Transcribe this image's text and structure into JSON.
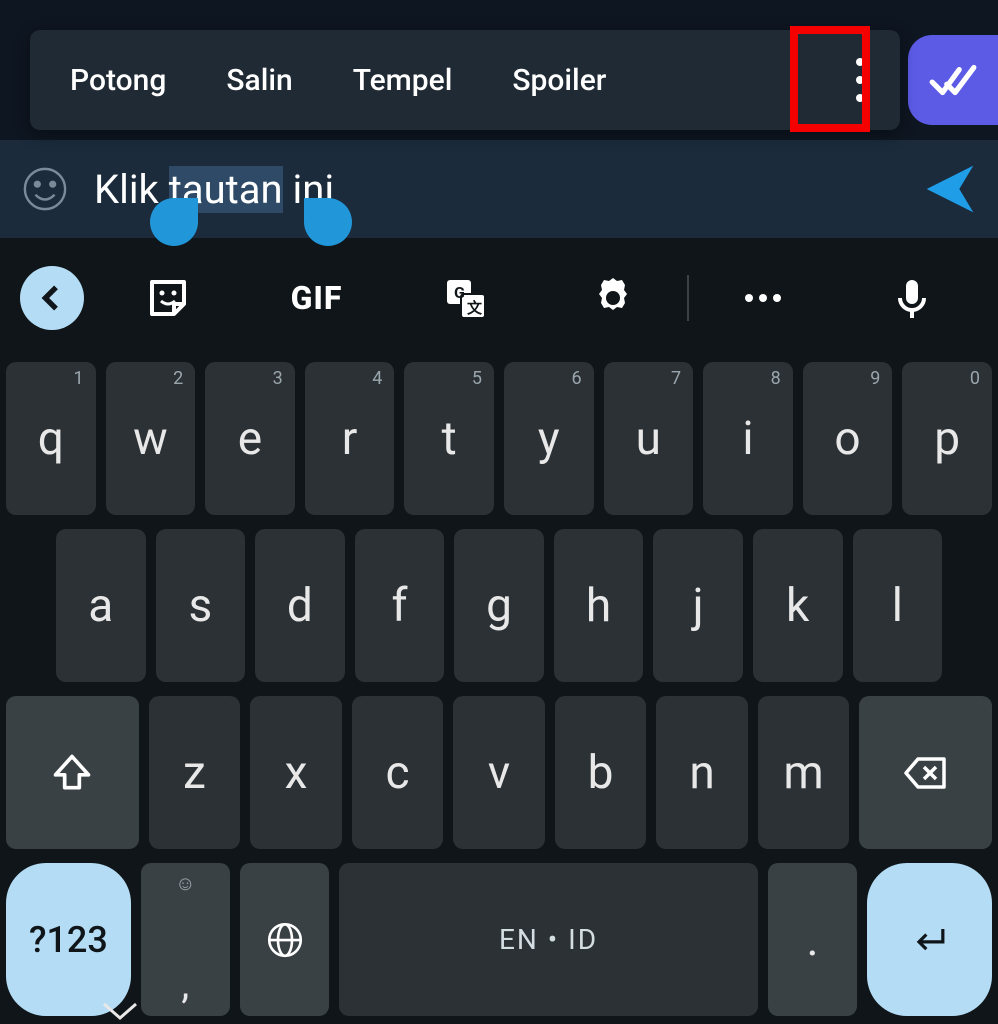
{
  "context_menu": {
    "items": [
      "Potong",
      "Salin",
      "Tempel",
      "Spoiler"
    ],
    "more_icon": "more-vertical"
  },
  "message_bubble": {
    "status": "read",
    "color": "#5b5be6"
  },
  "input": {
    "text_pre": "Klik ",
    "text_selected": "tautan",
    "text_post": " ini",
    "emoji_icon": "smiley",
    "send_icon": "send",
    "send_color": "#1f9de6"
  },
  "annotation": {
    "highlight": "more-button",
    "color": "#f40000"
  },
  "keyboard": {
    "toolbar": {
      "back_icon": "chevron-left",
      "sticker_icon": "sticker",
      "gif_label": "GIF",
      "translate_icon": "translate",
      "settings_icon": "gear",
      "more_icon": "more-horizontal",
      "mic_icon": "mic"
    },
    "row1": [
      {
        "k": "q",
        "n": "1"
      },
      {
        "k": "w",
        "n": "2"
      },
      {
        "k": "e",
        "n": "3"
      },
      {
        "k": "r",
        "n": "4"
      },
      {
        "k": "t",
        "n": "5"
      },
      {
        "k": "y",
        "n": "6"
      },
      {
        "k": "u",
        "n": "7"
      },
      {
        "k": "i",
        "n": "8"
      },
      {
        "k": "o",
        "n": "9"
      },
      {
        "k": "p",
        "n": "0"
      }
    ],
    "row2": [
      "a",
      "s",
      "d",
      "f",
      "g",
      "h",
      "j",
      "k",
      "l"
    ],
    "row3": [
      "z",
      "x",
      "c",
      "v",
      "b",
      "n",
      "m"
    ],
    "row4": {
      "symbols_label": "?123",
      "comma_emoji": "☺",
      "comma": ",",
      "globe_icon": "globe",
      "space_label": "EN • ID",
      "period": ".",
      "enter_icon": "enter"
    },
    "shift_icon": "shift",
    "backspace_icon": "backspace"
  }
}
